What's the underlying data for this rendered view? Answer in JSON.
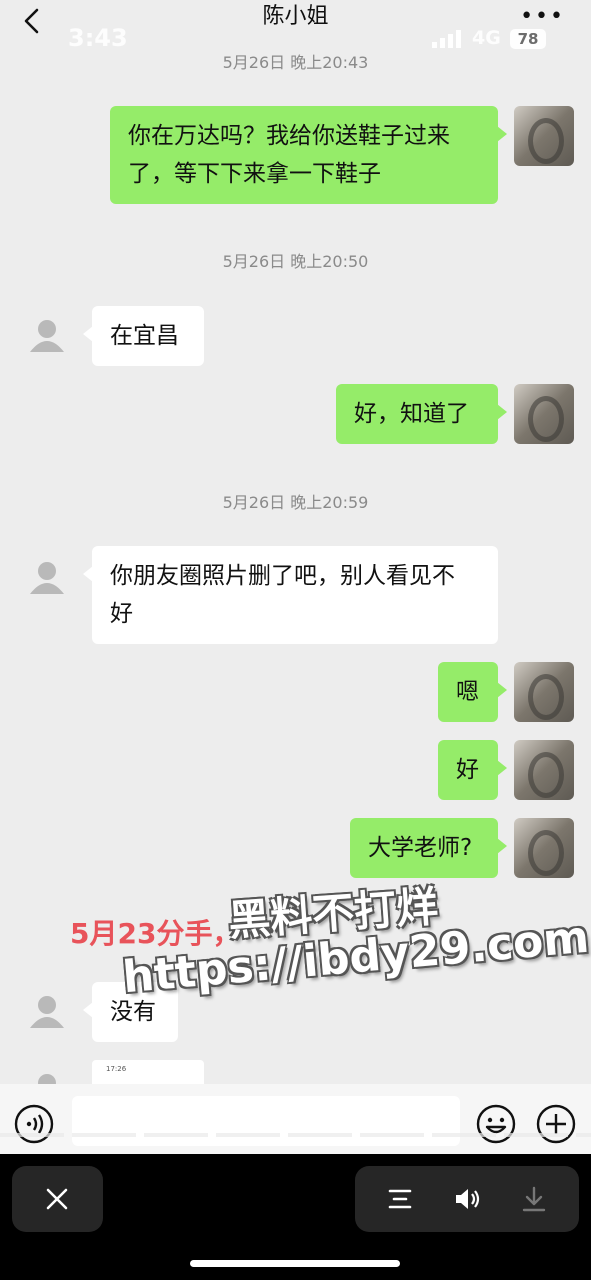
{
  "nav": {
    "title": "陈小姐",
    "back_icon": "chevron-left-icon",
    "more_label": "•••"
  },
  "status_bar": {
    "time": "3:43",
    "network": "4G",
    "battery": "78"
  },
  "messages": [
    {
      "type": "timestamp",
      "text": "5月26日 晚上20:43"
    },
    {
      "type": "sent",
      "lines": [
        "你在万达吗？我给你送鞋子过来",
        "了，等下下来拿一下鞋子"
      ]
    },
    {
      "type": "timestamp",
      "text": "5月26日 晚上20:50"
    },
    {
      "type": "received",
      "lines": [
        "在宜昌"
      ]
    },
    {
      "type": "sent",
      "lines": [
        "好，知道了"
      ]
    },
    {
      "type": "timestamp",
      "text": "5月26日 晚上20:59"
    },
    {
      "type": "received",
      "lines": [
        "你朋友圈照片删了吧，别人看见不",
        "好"
      ]
    },
    {
      "type": "sent",
      "lines": [
        "嗯"
      ]
    },
    {
      "type": "sent",
      "lines": [
        "好"
      ]
    },
    {
      "type": "sent",
      "lines": [
        "大学老师?"
      ]
    },
    {
      "type": "received",
      "lines": [
        "没有"
      ]
    },
    {
      "type": "received_image",
      "preview_time": "17:26"
    }
  ],
  "watermark": {
    "red_text": "5月23分手，",
    "gray_line1": "黑料不打烊",
    "gray_line2": "https://ibdy29.com"
  },
  "input_bar": {
    "voice_icon": "voice-icon",
    "emoji_icon": "emoji-icon",
    "plus_icon": "plus-icon"
  },
  "bottom_bar": {
    "close_icon": "close-icon",
    "menu_icon": "menu-lines-icon",
    "speaker_icon": "speaker-icon",
    "download_icon": "download-icon"
  }
}
